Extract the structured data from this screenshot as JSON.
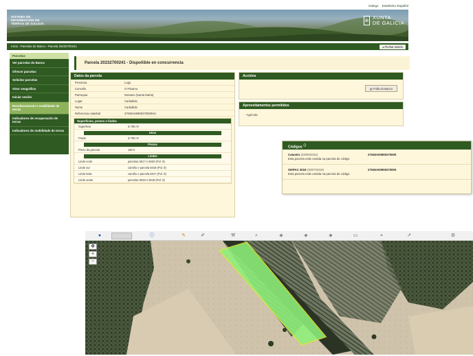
{
  "header": {
    "top_links": [
      "Galego",
      "Estatístico Español"
    ],
    "system_title": [
      "SISTEMA DE",
      "INFORMACIÓN DE",
      "TERRAS DE GALICIA"
    ],
    "brand_line1": "XUNTA",
    "brand_line2": "DE GALICIA"
  },
  "navbar": {
    "breadcrumb": "Inicio › Parcelas do Banco › Parcela 20232700241",
    "exit_label": "Pechar sesión"
  },
  "sidebar": {
    "title": "Parcelas",
    "items": [
      {
        "label": "Ver parcelas do Banco"
      },
      {
        "label": "Ofrecer parcelas"
      },
      {
        "label": "Solicitar parcelas"
      },
      {
        "label": "Visor xeográfico"
      },
      {
        "label": "Iniciar sesión"
      },
      {
        "label": "Recoñecemento e mobilidade de terras",
        "light": true
      },
      {
        "label": "Indicadores de recuperación de terras"
      },
      {
        "label": "Indicadores de mobilidade de terras"
      }
    ]
  },
  "page_title": "Parcela 20232700241 - Dispoñible en concurrencia",
  "parcel": {
    "title": "Datos da parcela",
    "fields": [
      {
        "k": "Provincia",
        "v": "Lugo"
      },
      {
        "k": "Concello",
        "v": "O Páramo"
      },
      {
        "k": "Parroquia",
        "v": "Nosamo (Santa María)"
      },
      {
        "k": "Lugar",
        "v": "Carballido"
      },
      {
        "k": "Nome",
        "v": "Carballido"
      },
      {
        "k": "Referencia catastral",
        "v": "27045A00900270000HU"
      }
    ],
    "surface_title": "Superficies, prezos e lindes",
    "surface_fields": [
      {
        "k": "Superficie",
        "v": "6.790 m²"
      }
    ],
    "use_title": "Usos",
    "use_fields": [
      {
        "k": "Prado",
        "v": "6.790 m²"
      }
    ],
    "price_title": "Prezos",
    "price_fields": [
      {
        "k": "Prezo da parcela",
        "v": "180 €"
      }
    ],
    "bounds_title": "Lindes",
    "bounds_fields": [
      {
        "k": "Linde norte",
        "v": "parcelas 5017 e 5020 (Pol. 9)"
      },
      {
        "k": "Linde sur",
        "v": "camiño e parcela 5018 (Pol. 9)"
      },
      {
        "k": "Linde leste",
        "v": "camiño e parcela 5017 (Pol. 9)"
      },
      {
        "k": "Linde oeste",
        "v": "parcelas 5028 e 5019 (Pol. 9)"
      }
    ]
  },
  "actions": {
    "title": "Accións",
    "file_button": "Folla do Banco"
  },
  "uses_allowed": {
    "title": "Aproveitamentos permitidos",
    "item": "Agrícola"
  },
  "codes": {
    "title": "Códigos",
    "rows": [
      {
        "name": "Catastro",
        "date": "(02/06/2023)",
        "desc": "Esta parcela está contida na parcela de código",
        "value": "27045A00900270000"
      },
      {
        "name": "SIXPAC 2019",
        "date": "(30/07/2019)",
        "desc": "Esta parcela está contida na parcela de código",
        "value": "27045A00900270000"
      }
    ]
  },
  "colors": {
    "brand_green": "#2f5a22",
    "panel_cream": "#fff7dc",
    "parcel_highlight": "#8ef07a",
    "parcel_outline": "#d8e83a"
  },
  "map": {
    "toolbar_icons": [
      "globe-icon",
      "select-tool-icon",
      "info-icon",
      "measure-icon",
      "draw-icon",
      "tool-icon",
      "search-icon",
      "layer-icon",
      "layer-icon",
      "layer-icon",
      "print-icon",
      "pin-icon",
      "share-icon",
      "settings-icon"
    ],
    "zoom_in": "+",
    "zoom_out": "−"
  }
}
